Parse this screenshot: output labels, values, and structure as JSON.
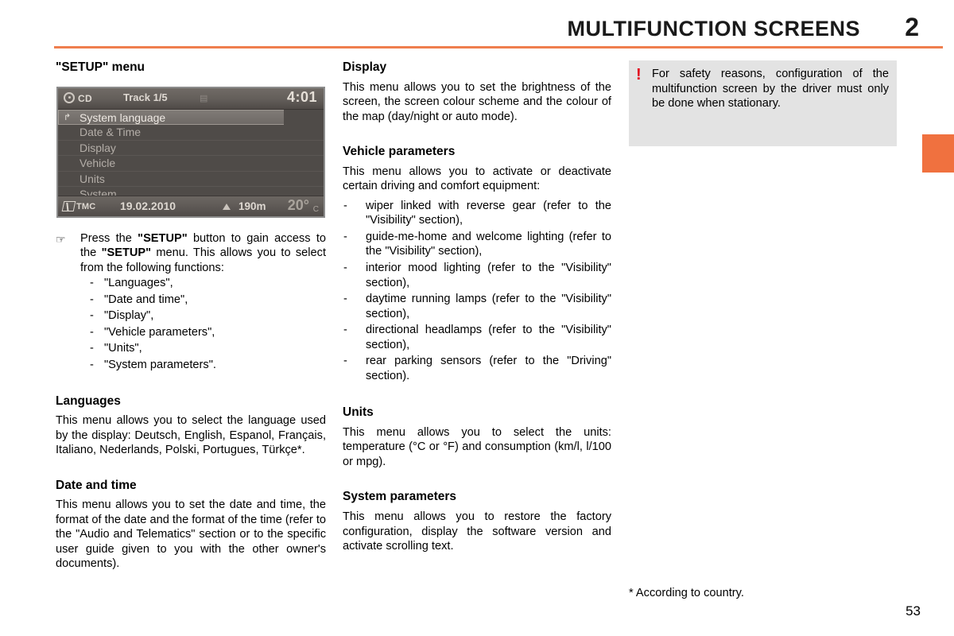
{
  "header": {
    "title": "MULTIFUNCTION SCREENS",
    "chapter": "2",
    "rule_color": "#ef7e4e",
    "tab_color": "#f0713f"
  },
  "screen": {
    "source_icon": "cd-disc-icon",
    "source_label": "CD",
    "track": "Track 1/5",
    "mid_icon": "list-icon",
    "clock": "4:01",
    "menu_items": [
      {
        "label": "System language",
        "selected": true,
        "icon": "enter-arrow-icon"
      },
      {
        "label": "Date & Time",
        "selected": false
      },
      {
        "label": "Display",
        "selected": false
      },
      {
        "label": "Vehicle",
        "selected": false
      },
      {
        "label": "Units",
        "selected": false
      },
      {
        "label": "System",
        "selected": false
      }
    ],
    "status": {
      "tmc_label": "TMC",
      "date": "19.02.2010",
      "altitude": "190m",
      "temperature": "20°",
      "temperature_unit": "C"
    }
  },
  "left": {
    "section_title": "\"SETUP\" menu",
    "intro_icon": "pointing-hand-icon",
    "intro_parts": {
      "p1": "Press the ",
      "b1": "\"SETUP\"",
      "p2": " button to gain access to the ",
      "b2": "\"SETUP\"",
      "p3": " menu. This allows you to select from the following functions:"
    },
    "functions": [
      "\"Languages\",",
      "\"Date and time\",",
      "\"Display\",",
      "\"Vehicle parameters\",",
      "\"Units\",",
      "\"System parameters\"."
    ],
    "languages": {
      "title": "Languages",
      "body": "This menu allows you to select the language used by the display: Deutsch, English, Espanol, Français, Italiano, Nederlands, Polski, Portugues, Türkçe*."
    },
    "date_and_time": {
      "title": "Date and time",
      "body": "This menu allows you to set the date and time, the format of the date and the format of the time (refer to the \"Audio and Telematics\" section or to the specific user guide given to you with the other owner's documents)."
    }
  },
  "middle": {
    "display": {
      "title": "Display",
      "body": "This menu allows you to set the brightness of the screen, the screen colour scheme and the colour of the map (day/night or auto mode)."
    },
    "vehicle_parameters": {
      "title": "Vehicle parameters",
      "body": "This menu allows you to activate or deactivate certain driving and comfort equipment:",
      "items": [
        "wiper linked with reverse gear (refer to the \"Visibility\" section),",
        "guide-me-home and welcome lighting (refer to the \"Visibility\" section),",
        "interior mood lighting (refer to the \"Visibility\" section),",
        "daytime running lamps (refer to the \"Visibility\" section),",
        "directional headlamps (refer to the \"Visibility\" section),",
        "rear parking sensors (refer to the \"Driving\" section)."
      ],
      "dash": "-"
    },
    "units": {
      "title": "Units",
      "body": "This menu allows you to select the units: temperature (°C or °F) and consumption (km/l, l/100 or mpg)."
    },
    "system_parameters": {
      "title": "System parameters",
      "body": "This menu allows you to restore the factory configuration, display the software version and activate scrolling text."
    }
  },
  "right": {
    "warning": {
      "icon": "exclamation-icon",
      "icon_color": "#e2001a",
      "text": "For safety reasons, configuration of the multifunction screen by the driver must only be done when stationary."
    }
  },
  "footer": {
    "footnote": "* According to country.",
    "page_number": "53"
  }
}
